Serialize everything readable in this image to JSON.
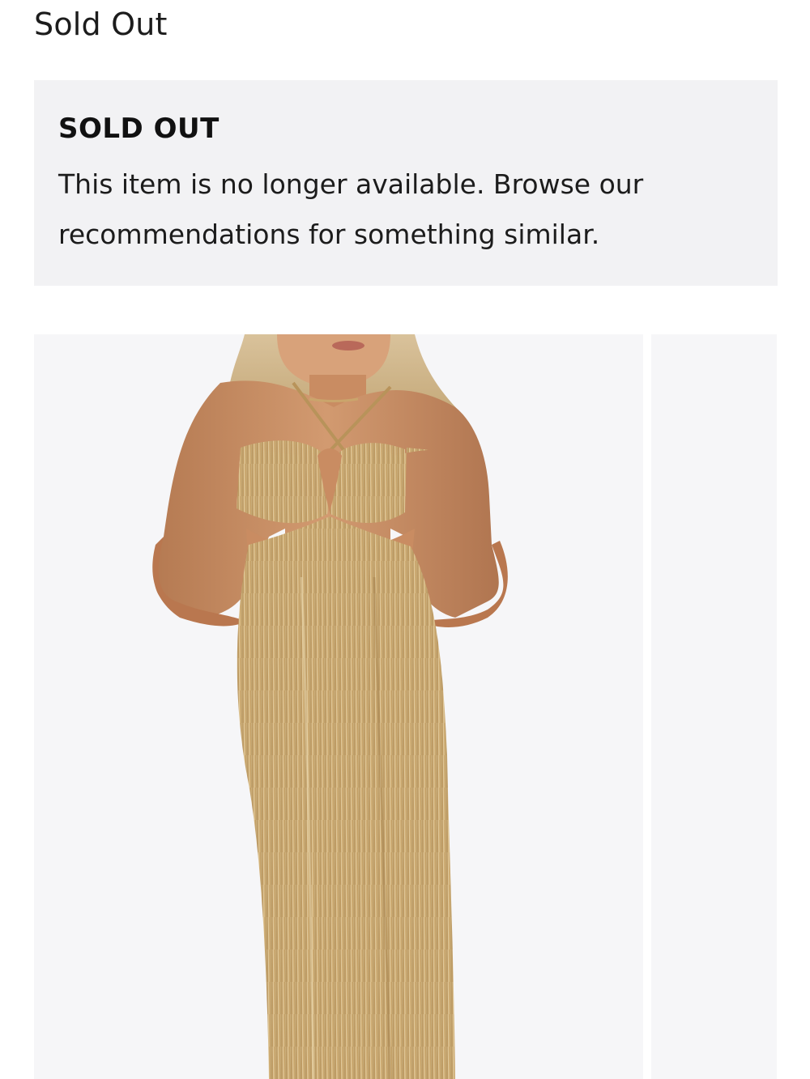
{
  "header": {
    "status_label": "Sold Out"
  },
  "notice": {
    "title": "SOLD OUT",
    "message": "This item is no longer available. Browse our recommendations for something similar."
  },
  "gallery": {
    "images": [
      {
        "alt": "Gold pleated halter cut-out maxi dress"
      },
      {
        "alt": ""
      }
    ]
  },
  "colors": {
    "notice_background": "#f2f2f4",
    "image_background": "#f6f6f8",
    "dress_gold": "#c9a66b"
  }
}
